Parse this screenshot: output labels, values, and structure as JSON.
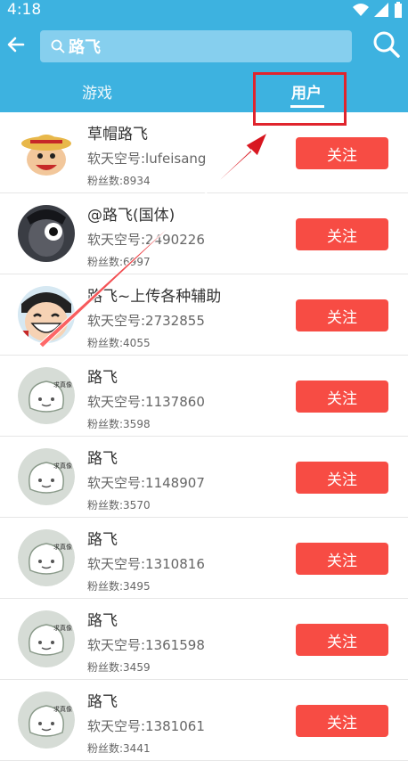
{
  "status": {
    "time": "4:18"
  },
  "search": {
    "query": "路飞"
  },
  "tabs": {
    "game": "游戏",
    "user": "用户"
  },
  "users": [
    {
      "name": "草帽路飞",
      "uid": "软天空号:lufeisang",
      "fans": "粉丝数:8934",
      "avatar": "straw-hat",
      "follow": "关注"
    },
    {
      "name": "@路飞(国体)",
      "uid": "软天空号:2490226",
      "fans": "粉丝数:6997",
      "avatar": "dark-luffy",
      "follow": "关注"
    },
    {
      "name": "路飞~上传各种辅助",
      "uid": "软天空号:2732855",
      "fans": "粉丝数:4055",
      "avatar": "laughing",
      "follow": "关注"
    },
    {
      "name": "路飞",
      "uid": "软天空号:1137860",
      "fans": "粉丝数:3598",
      "avatar": "default",
      "follow": "关注"
    },
    {
      "name": "路飞",
      "uid": "软天空号:1148907",
      "fans": "粉丝数:3570",
      "avatar": "default",
      "follow": "关注"
    },
    {
      "name": "路飞",
      "uid": "软天空号:1310816",
      "fans": "粉丝数:3495",
      "avatar": "default",
      "follow": "关注"
    },
    {
      "name": "路飞",
      "uid": "软天空号:1361598",
      "fans": "粉丝数:3459",
      "avatar": "default",
      "follow": "关注"
    },
    {
      "name": "路飞",
      "uid": "软天空号:1381061",
      "fans": "粉丝数:3441",
      "avatar": "default",
      "follow": "关注"
    }
  ],
  "default_avatar_text": "求真像",
  "colors": {
    "primary": "#3db2e0",
    "follow": "#f74c44",
    "highlight": "#e0242d"
  }
}
